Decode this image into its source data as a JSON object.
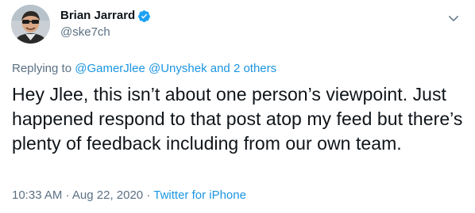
{
  "author": {
    "name": "Brian Jarrard",
    "handle": "@ske7ch",
    "verified": true
  },
  "reply": {
    "prefix": "Replying to",
    "mentions": [
      "@GamerJlee",
      "@Unyshek"
    ],
    "and_others": "and 2 others"
  },
  "tweet": {
    "text": "Hey Jlee, this isn’t about one person’s viewpoint. Just happened respond to that post atop my feed but there’s plenty of feedback including from our own team."
  },
  "meta": {
    "time": "10:33 AM",
    "separator1": "·",
    "date": "Aug 22, 2020",
    "separator2": "·",
    "source": "Twitter for iPhone"
  },
  "icons": {
    "verified": "verified-badge-icon",
    "more": "chevron-down-icon"
  },
  "colors": {
    "accent": "#1b95e0",
    "secondary_text": "#5b7083",
    "primary_text": "#0f1419"
  }
}
